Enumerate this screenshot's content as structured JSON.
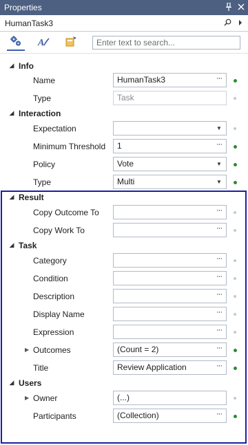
{
  "window": {
    "title": "Properties",
    "pin_glyph": "📌",
    "close_glyph": "✕"
  },
  "object": {
    "name": "HumanTask3"
  },
  "toolbar": {
    "search_placeholder": "Enter text to search..."
  },
  "categories": {
    "info": "Info",
    "interaction": "Interaction",
    "result": "Result",
    "task": "Task",
    "users": "Users"
  },
  "props": {
    "name": {
      "label": "Name",
      "value": "HumanTask3"
    },
    "type_info": {
      "label": "Type",
      "value": "Task"
    },
    "expectation": {
      "label": "Expectation",
      "value": ""
    },
    "minimum_threshold": {
      "label": "Minimum Threshold",
      "value": "1"
    },
    "policy": {
      "label": "Policy",
      "value": "Vote"
    },
    "type_interaction": {
      "label": "Type",
      "value": "Multi"
    },
    "copy_outcome_to": {
      "label": "Copy Outcome To",
      "value": ""
    },
    "copy_work_to": {
      "label": "Copy Work To",
      "value": ""
    },
    "category": {
      "label": "Category",
      "value": ""
    },
    "condition": {
      "label": "Condition",
      "value": ""
    },
    "description": {
      "label": "Description",
      "value": ""
    },
    "display_name": {
      "label": "Display Name",
      "value": ""
    },
    "expression": {
      "label": "Expression",
      "value": ""
    },
    "outcomes": {
      "label": "Outcomes",
      "value": "(Count = 2)"
    },
    "title": {
      "label": "Title",
      "value": "Review Application"
    },
    "owner": {
      "label": "Owner",
      "value": "(...)"
    },
    "participants": {
      "label": "Participants",
      "value": "(Collection)"
    }
  },
  "colors": {
    "titlebar": "#4d6082",
    "set_dot": "#2f8a2f",
    "selection_border": "#1b1fa0"
  }
}
